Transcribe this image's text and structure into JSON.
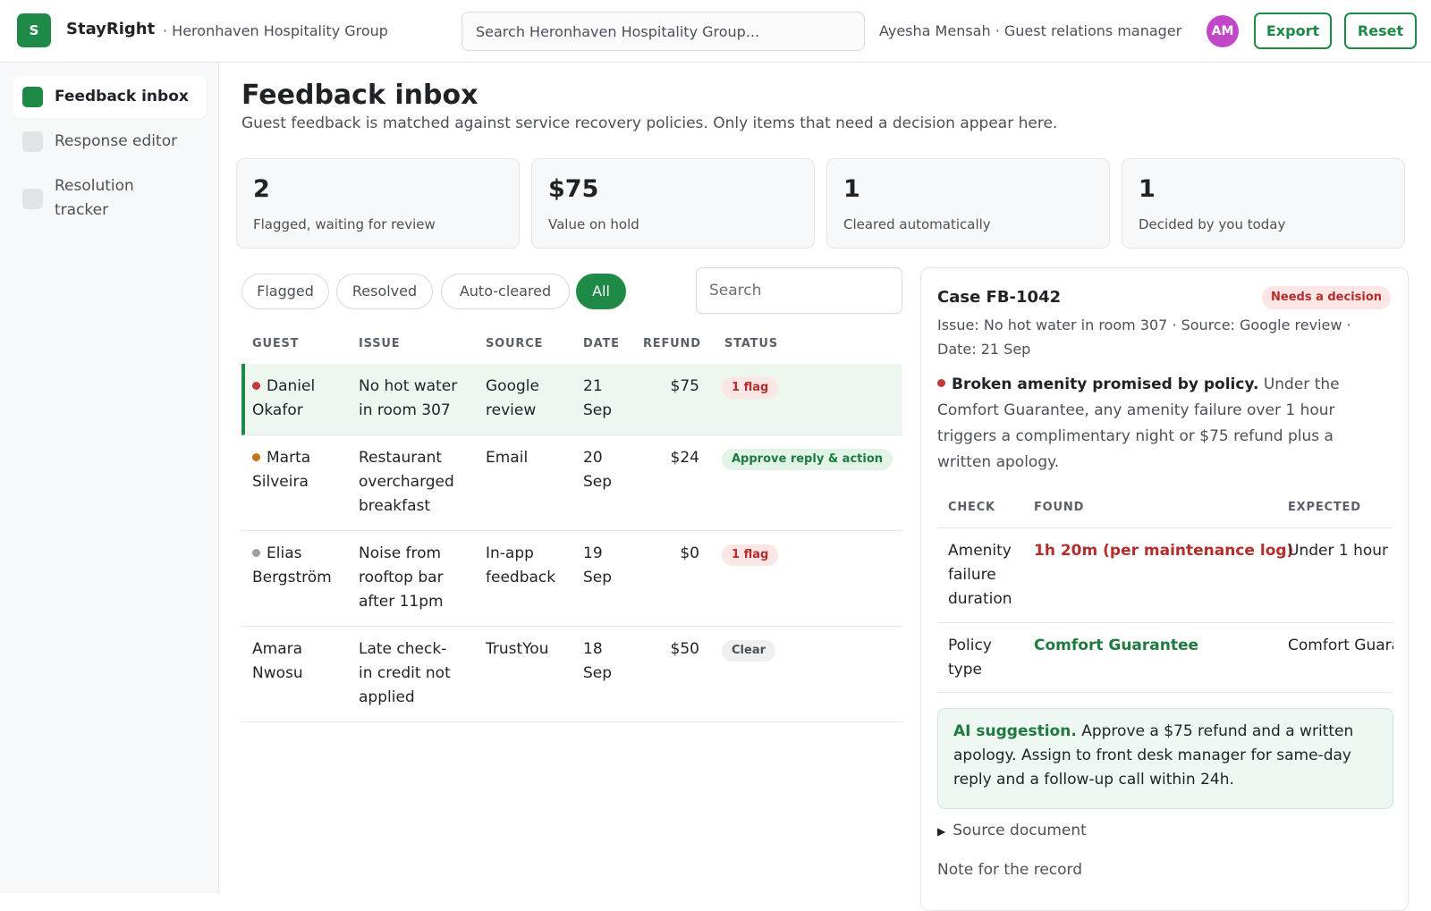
{
  "app": {
    "logo_letter": "S",
    "brand": "StayRight",
    "org": "· Heronhaven Hospitality Group",
    "search_placeholder": "Search Heronhaven Hospitality Group...",
    "user": "Ayesha Mensah · Guest relations manager",
    "avatar_initials": "AM",
    "export_label": "Export",
    "reset_label": "Reset",
    "accent_color": "#1f8a47"
  },
  "sidebar": {
    "items": [
      {
        "label": "Feedback inbox",
        "active": true
      },
      {
        "label": "Response editor",
        "active": false
      },
      {
        "label": "Resolution tracker",
        "active": false
      }
    ]
  },
  "page": {
    "title": "Feedback inbox",
    "subtitle": "Guest feedback is matched against service recovery policies. Only items that need a decision appear here."
  },
  "stats": [
    {
      "value": "2",
      "label": "Flagged, waiting for review"
    },
    {
      "value": "$75",
      "label": "Value on hold"
    },
    {
      "value": "1",
      "label": "Cleared automatically"
    },
    {
      "value": "1",
      "label": "Decided by you today"
    }
  ],
  "filters": {
    "chips": [
      {
        "label": "Flagged",
        "active": false
      },
      {
        "label": "Resolved",
        "active": false
      },
      {
        "label": "Auto-cleared",
        "active": false
      },
      {
        "label": "All",
        "active": true
      }
    ],
    "search_placeholder": "Search"
  },
  "table": {
    "headers": [
      "GUEST",
      "ISSUE",
      "SOURCE",
      "DATE",
      "REFUND",
      "STATUS"
    ],
    "rows": [
      {
        "dot": "red",
        "guest_line1": "Daniel",
        "guest_line2": "Okafor",
        "issue": [
          "No hot water",
          "in room 307"
        ],
        "source": [
          "Google",
          "review"
        ],
        "date": [
          "21",
          "Sep"
        ],
        "refund": "$75",
        "status": "1 flag",
        "status_tone": "red",
        "selected": true
      },
      {
        "dot": "orange",
        "guest_line1": "Marta",
        "guest_line2": "Silveira",
        "issue": [
          "Restaurant",
          "overcharged",
          "breakfast"
        ],
        "source": [
          "Email"
        ],
        "date": [
          "20",
          "Sep"
        ],
        "refund": "$24",
        "status": "Approve reply & action",
        "status_tone": "green",
        "selected": false
      },
      {
        "dot": "gray",
        "guest_line1": "Elias",
        "guest_line2": "Bergström",
        "issue": [
          "Noise from",
          "rooftop bar",
          "after 11pm"
        ],
        "source": [
          "In-app",
          "feedback"
        ],
        "date": [
          "19",
          "Sep"
        ],
        "refund": "$0",
        "status": "1 flag",
        "status_tone": "red",
        "selected": false
      },
      {
        "dot": "none",
        "guest_line1": "Amara",
        "guest_line2": "Nwosu",
        "issue": [
          "Late check-",
          "in credit not",
          "applied"
        ],
        "source": [
          "TrustYou"
        ],
        "date": [
          "18",
          "Sep"
        ],
        "refund": "$50",
        "status": "Clear",
        "status_tone": "gray",
        "selected": false
      }
    ]
  },
  "case": {
    "title": "Case FB-1042",
    "badge": "Needs a decision",
    "meta": "Issue: No hot water in room 307 · Source: Google review · Date: 21 Sep",
    "finding_title": "Broken amenity promised by policy.",
    "finding_text": "Under the Comfort Guarantee, any amenity failure over 1 hour triggers a complimentary night or $75 refund plus a written apology.",
    "checks_headers": [
      "CHECK",
      "FOUND",
      "EXPECTED"
    ],
    "checks": [
      {
        "check": [
          "Amenity",
          "failure",
          "duration"
        ],
        "found": "1h 20m (per maintenance log)",
        "found_tone": "red",
        "expected": "Under 1 hour"
      },
      {
        "check": [
          "Policy",
          "type"
        ],
        "found": "Comfort Guarantee",
        "found_tone": "green",
        "expected": "Comfort Guarantee"
      }
    ],
    "ai_lead": "AI suggestion.",
    "ai_text": "Approve a $75 refund and a written apology. Assign to front desk manager for same-day reply and a follow-up call within 24h.",
    "source_doc": "Source document",
    "note_label": "Note for the record"
  }
}
